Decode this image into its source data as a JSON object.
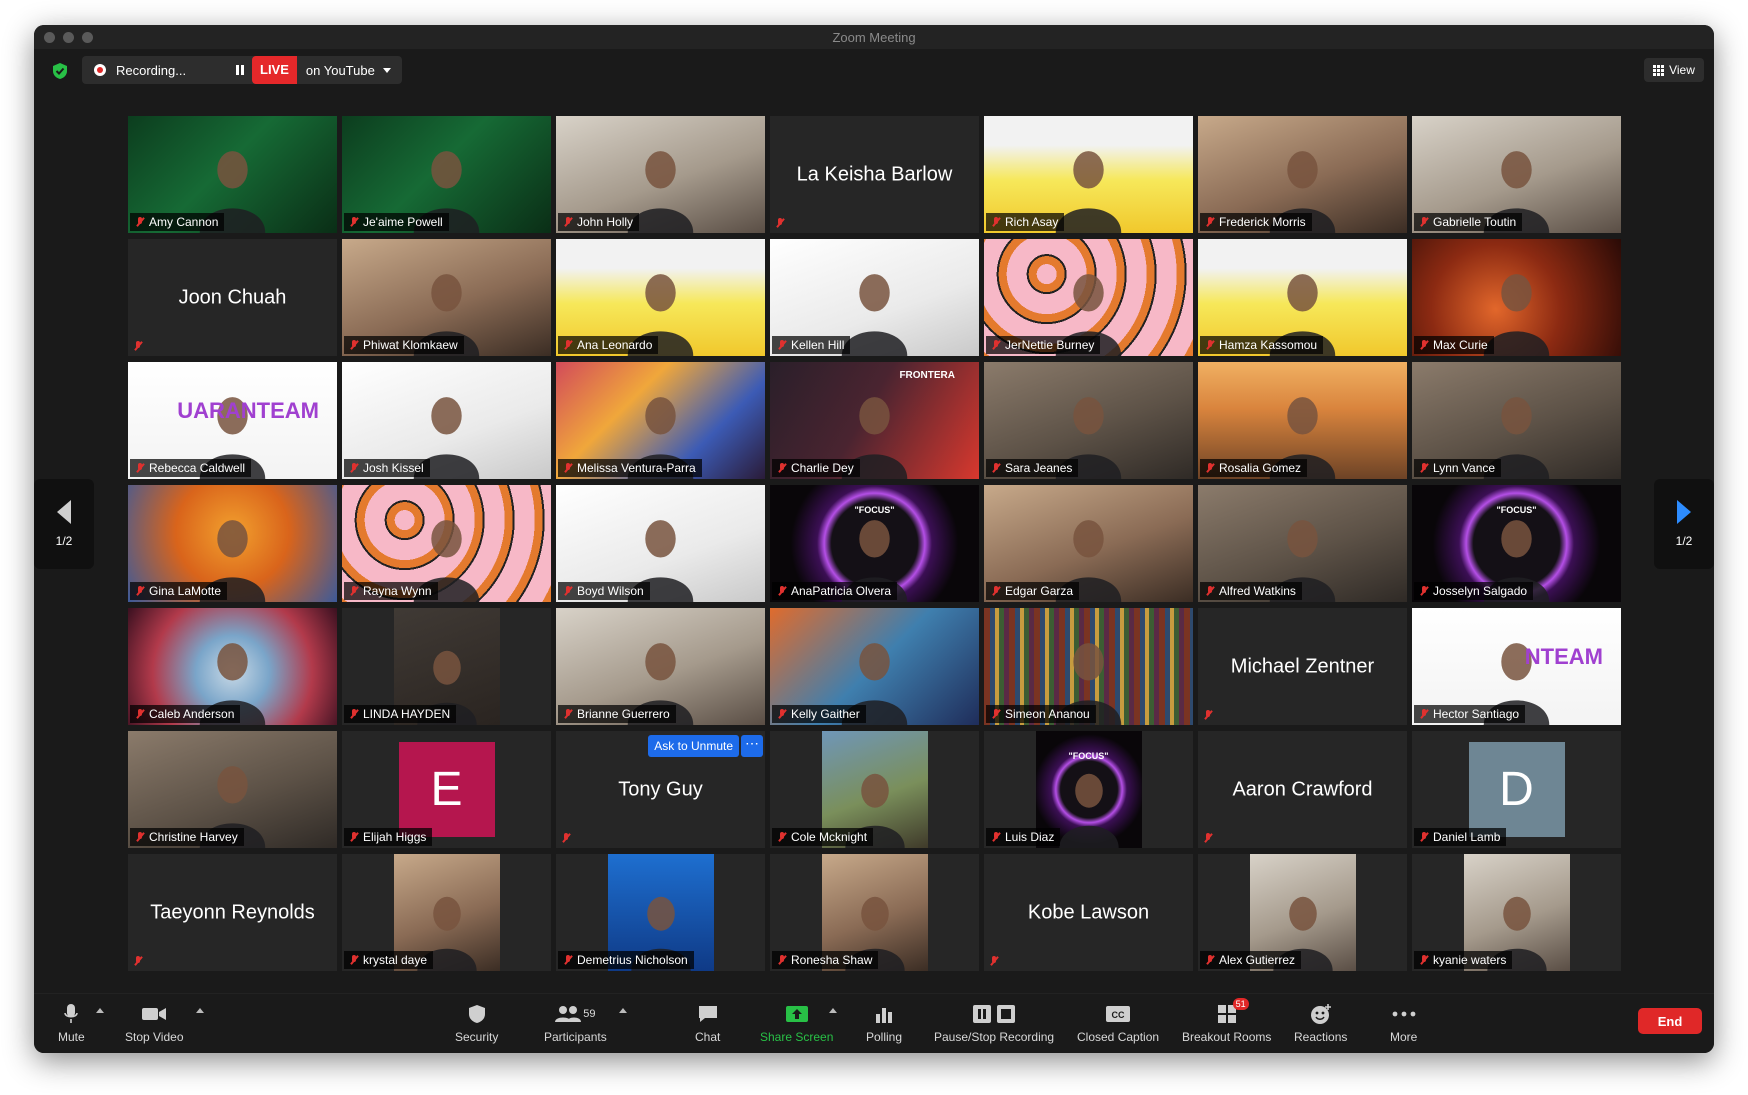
{
  "window": {
    "title": "Zoom Meeting"
  },
  "topbar": {
    "recording_label": "Recording...",
    "live_badge": "LIVE",
    "live_target": "on YouTube",
    "view_label": "View"
  },
  "pager": {
    "left_label": "1/2",
    "right_label": "1/2"
  },
  "tiles": [
    {
      "name": "Amy Cannon",
      "kind": "video",
      "art": "sc20"
    },
    {
      "name": "Je'aime Powell",
      "kind": "video",
      "art": "sc20"
    },
    {
      "name": "John Holly",
      "kind": "video",
      "art": "person-light"
    },
    {
      "name": "La Keisha Barlow",
      "kind": "nameonly"
    },
    {
      "name": "Rich Asay",
      "kind": "video",
      "art": "railroad"
    },
    {
      "name": "Frederick Morris",
      "kind": "video",
      "art": "person-warm"
    },
    {
      "name": "Gabrielle Toutin",
      "kind": "video",
      "art": "person-light"
    },
    {
      "name": "Joon Chuah",
      "kind": "nameonly"
    },
    {
      "name": "Phiwat Klomkaew",
      "kind": "video",
      "art": "person-warm"
    },
    {
      "name": "Ana Leonardo",
      "kind": "video",
      "art": "railroad"
    },
    {
      "name": "Kellen Hill",
      "kind": "video",
      "art": "sketch"
    },
    {
      "name": "JerNettie Burney",
      "kind": "video",
      "art": "tigers"
    },
    {
      "name": "Hamza Kassomou",
      "kind": "video",
      "art": "railroad"
    },
    {
      "name": "Max Curie",
      "kind": "video",
      "art": "mars"
    },
    {
      "name": "Rebecca Caldwell",
      "kind": "video",
      "art": "quaranteam",
      "logo_text": "UARANTEAM"
    },
    {
      "name": "Josh Kissel",
      "kind": "video",
      "art": "sketch"
    },
    {
      "name": "Melissa Ventura-Parra",
      "kind": "video",
      "art": "colorful"
    },
    {
      "name": "Charlie Dey",
      "kind": "video",
      "art": "frontera",
      "logo_text": "FRONTERA"
    },
    {
      "name": "Sara Jeanes",
      "kind": "video",
      "art": "office"
    },
    {
      "name": "Rosalia Gomez",
      "kind": "video",
      "art": "sunset"
    },
    {
      "name": "Lynn Vance",
      "kind": "video",
      "art": "office"
    },
    {
      "name": "Gina LaMotte",
      "kind": "video",
      "art": "autumn",
      "highlight": true
    },
    {
      "name": "Rayna Wynn",
      "kind": "video",
      "art": "tigers"
    },
    {
      "name": "Boyd Wilson",
      "kind": "video",
      "art": "sketch"
    },
    {
      "name": "AnaPatricia Olvera",
      "kind": "video",
      "art": "focus",
      "logo_text": "\"FOCUS\""
    },
    {
      "name": "Edgar Garza",
      "kind": "video",
      "art": "person-warm"
    },
    {
      "name": "Alfred Watkins",
      "kind": "video",
      "art": "office"
    },
    {
      "name": "Josselyn Salgado",
      "kind": "video",
      "art": "focus",
      "logo_text": "\"FOCUS\""
    },
    {
      "name": "Caleb Anderson",
      "kind": "video",
      "art": "virus"
    },
    {
      "name": "LINDA HAYDEN",
      "kind": "video",
      "art": "person-dark",
      "inset": true
    },
    {
      "name": "Brianne Guerrero",
      "kind": "video",
      "art": "person-light"
    },
    {
      "name": "Kelly Gaither",
      "kind": "video",
      "art": "longhorn"
    },
    {
      "name": "Simeon Ananou",
      "kind": "video",
      "art": "books"
    },
    {
      "name": "Michael Zentner",
      "kind": "nameonly"
    },
    {
      "name": "Hector Santiago",
      "kind": "video",
      "art": "quaranteam",
      "logo_text": "NTEAM"
    },
    {
      "name": "Christine Harvey",
      "kind": "video",
      "art": "office"
    },
    {
      "name": "Elijah Higgs",
      "kind": "letter",
      "letter": "E",
      "color": "#b5164e"
    },
    {
      "name": "Tony Guy",
      "kind": "nameonly",
      "ask_unmute": "Ask to Unmute",
      "more": "⋯"
    },
    {
      "name": "Cole Mcknight",
      "kind": "video",
      "art": "outdoor",
      "inset": true
    },
    {
      "name": "Luis Diaz",
      "kind": "video",
      "art": "focus",
      "inset": true,
      "logo_text": "\"FOCUS\""
    },
    {
      "name": "Aaron Crawford",
      "kind": "nameonly"
    },
    {
      "name": "Daniel Lamb",
      "kind": "letter",
      "letter": "D",
      "color": "#6e8694"
    },
    {
      "name": "Taeyonn Reynolds",
      "kind": "nameonly"
    },
    {
      "name": "krystal daye",
      "kind": "video",
      "art": "person-warm",
      "inset": true
    },
    {
      "name": "Demetrius Nicholson",
      "kind": "video",
      "art": "blue",
      "inset": true
    },
    {
      "name": "Ronesha Shaw",
      "kind": "video",
      "art": "person-warm",
      "inset": true
    },
    {
      "name": "Kobe Lawson",
      "kind": "nameonly"
    },
    {
      "name": "Alex Gutierrez",
      "kind": "video",
      "art": "person-light",
      "inset": true
    },
    {
      "name": "kyanie waters",
      "kind": "video",
      "art": "person-light",
      "inset": true
    }
  ],
  "toolbar": {
    "mute": "Mute",
    "stop_video": "Stop Video",
    "security": "Security",
    "participants": "Participants",
    "participants_count": "59",
    "chat": "Chat",
    "share_screen": "Share Screen",
    "polling": "Polling",
    "pause_stop_recording": "Pause/Stop Recording",
    "closed_caption": "Closed Caption",
    "breakout_rooms": "Breakout Rooms",
    "breakout_badge": "51",
    "reactions": "Reactions",
    "more": "More",
    "end": "End"
  },
  "colors": {
    "live_red": "#e5282a",
    "share_green": "#28c046",
    "active_speaker": "#c7e16a",
    "ask_unmute_blue": "#1d6bea",
    "end_red": "#e02828"
  }
}
